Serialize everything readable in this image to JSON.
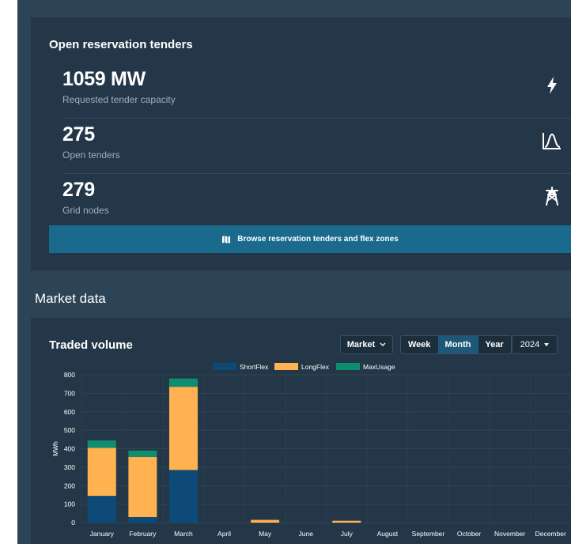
{
  "tenders": {
    "title": "Open reservation tenders",
    "stats": [
      {
        "value": "1059 MW",
        "label": "Requested tender capacity",
        "icon": "lightning-icon"
      },
      {
        "value": "275",
        "label": "Open tenders",
        "icon": "distribution-curve-icon"
      },
      {
        "value": "279",
        "label": "Grid nodes",
        "icon": "power-pylon-icon"
      }
    ],
    "browse_label": "Browse reservation tenders and flex zones",
    "browse_icon": "map-icon"
  },
  "market": {
    "heading": "Market data",
    "volume_title": "Traded volume",
    "market_select": "Market",
    "periods": [
      "Week",
      "Month",
      "Year"
    ],
    "active_period": "Month",
    "year": "2024"
  },
  "colors": {
    "ShortFlex": "#0d4a78",
    "LongFlex": "#ffb24f",
    "MaxUsage": "#0f8e6f",
    "accent_button": "#196a8d"
  },
  "chart_data": {
    "type": "bar",
    "stacked": true,
    "ylabel": "MWh",
    "ylim": [
      0,
      800
    ],
    "yticks": [
      0,
      100,
      200,
      300,
      400,
      500,
      600,
      700,
      800
    ],
    "legend_position": "top",
    "grid": true,
    "categories": [
      "January",
      "February",
      "March",
      "April",
      "May",
      "June",
      "July",
      "August",
      "September",
      "October",
      "November",
      "December"
    ],
    "series": [
      {
        "name": "ShortFlex",
        "values": [
          145,
          30,
          285,
          0,
          0,
          0,
          0,
          0,
          0,
          0,
          0,
          0
        ]
      },
      {
        "name": "LongFlex",
        "values": [
          260,
          325,
          450,
          0,
          15,
          0,
          10,
          0,
          0,
          0,
          0,
          0
        ]
      },
      {
        "name": "MaxUsage",
        "values": [
          40,
          35,
          45,
          0,
          0,
          0,
          0,
          0,
          0,
          0,
          0,
          0
        ]
      }
    ]
  }
}
